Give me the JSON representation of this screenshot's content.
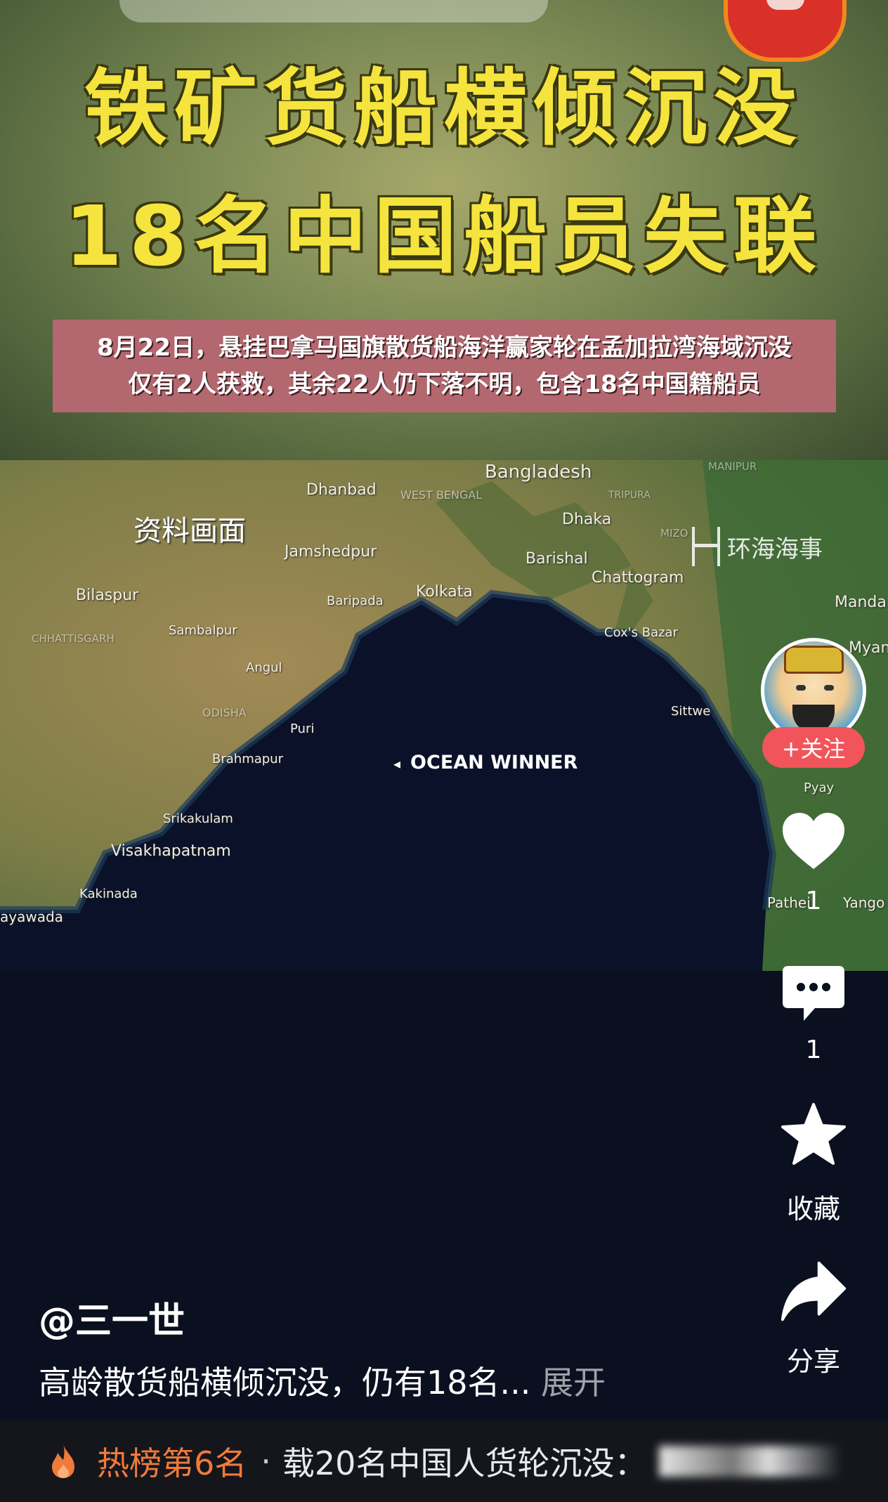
{
  "video": {
    "title_line1": "铁矿货船横倾沉没",
    "title_line2": "18名中国船员失联",
    "subtitle_line1": "8月22日，悬挂巴拿马国旗散货船海洋赢家轮在孟加拉湾海域沉没",
    "subtitle_line2": "仅有2人获救，其余22人仍下落不明，包含18名中国籍船员",
    "archive_label": "资料画面",
    "watermark": "环海海事",
    "ocean_label": "OCEAN WINNER",
    "map_labels": {
      "bangladesh": "Bangladesh",
      "dhaka": "Dhaka",
      "dhanbad": "Dhanbad",
      "west_bengal": "WEST BENGAL",
      "jamshedpur": "Jamshedpur",
      "barishal": "Barishal",
      "kolkata": "Kolkata",
      "chattogram": "Chattogram",
      "bilaspur": "Bilaspur",
      "baripada": "Baripada",
      "sambalpur": "Sambalpur",
      "chhattisgarh": "CHHATTISGARH",
      "angul": "Angul",
      "coxs_bazar": "Cox's Bazar",
      "odisha": "ODISHA",
      "puri": "Puri",
      "brahmapur": "Brahmapur",
      "srikakulam": "Srikakulam",
      "visakhapatnam": "Visakhapatnam",
      "kakinada": "Kakinada",
      "vijayawada": "ayawada",
      "sittwe": "Sittwe",
      "mandalay": "Mandala",
      "myanmar": "Myan",
      "pyay": "Pyay",
      "pathein": "Pathei",
      "yangon": "Yango",
      "manipur": "MANIPUR",
      "tripura": "TRIPURA",
      "mizoram": "MIZO"
    }
  },
  "rail": {
    "follow_label": "+关注",
    "like_count": "1",
    "comment_count": "1",
    "favorite_label": "收藏",
    "share_label": "分享"
  },
  "caption": {
    "author": "@三一世",
    "description": "高龄散货船横倾沉没，仍有18名...",
    "expand_label": "展开"
  },
  "hotbar": {
    "rank_label": "热榜第6名",
    "separator": "·",
    "topic": "载20名中国人货轮沉没："
  },
  "colors": {
    "title_yellow": "#f5e43d",
    "subtitle_bg": "#b3676e",
    "follow_red": "#f2545b",
    "hot_orange": "#f07a3a",
    "background": "#0b1020"
  }
}
